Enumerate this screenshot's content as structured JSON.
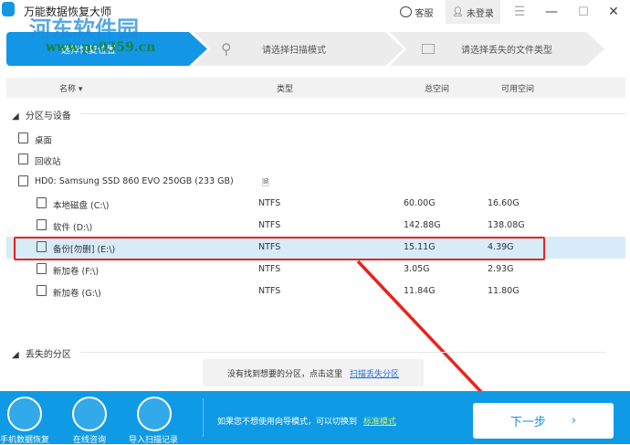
{
  "app": {
    "title": "万能数据恢复大师"
  },
  "titlebar": {
    "support": "客服",
    "login": "未登录"
  },
  "steps": [
    {
      "label": "选择恢复位置"
    },
    {
      "label": "请选择扫描模式"
    },
    {
      "label": "请选择丢失的文件类型"
    }
  ],
  "table": {
    "columns": [
      "名称",
      "类型",
      "总空间",
      "可用空间"
    ]
  },
  "sections": {
    "devices": "分区与设备",
    "lost": "丢失的分区"
  },
  "items": [
    {
      "name": "桌面"
    },
    {
      "name": "回收站"
    },
    {
      "name": "HD0: Samsung SSD 860 EVO 250GB (233 GB)"
    }
  ],
  "partitions": [
    {
      "name": "本地磁盘 (C:\\)",
      "type": "NTFS",
      "total": "60.00G",
      "free": "16.60G"
    },
    {
      "name": "软件 (D:\\)",
      "type": "NTFS",
      "total": "142.88G",
      "free": "138.08G"
    },
    {
      "name": "备份[勿删] (E:\\)",
      "type": "NTFS",
      "total": "15.11G",
      "free": "4.39G"
    },
    {
      "name": "新加卷 (F:\\)",
      "type": "NTFS",
      "total": "3.05G",
      "free": "2.93G"
    },
    {
      "name": "新加卷 (G:\\)",
      "type": "NTFS",
      "total": "11.84G",
      "free": "11.80G"
    }
  ],
  "hint": {
    "text": "没有找到想要的分区，点击这里",
    "link": "扫描丢失分区"
  },
  "bottom": {
    "tools": [
      "手机数据恢复",
      "在线咨询",
      "导入扫描记录"
    ],
    "switch_text": "如果您不想使用向导模式，可以切换到",
    "switch_link": "标准模式",
    "next": "下一步"
  },
  "watermark": {
    "name": "河东软件园",
    "url": "www.pc0359.cn"
  },
  "colors": {
    "accent": "#0f9ae6",
    "highlight": "#e8231f"
  }
}
